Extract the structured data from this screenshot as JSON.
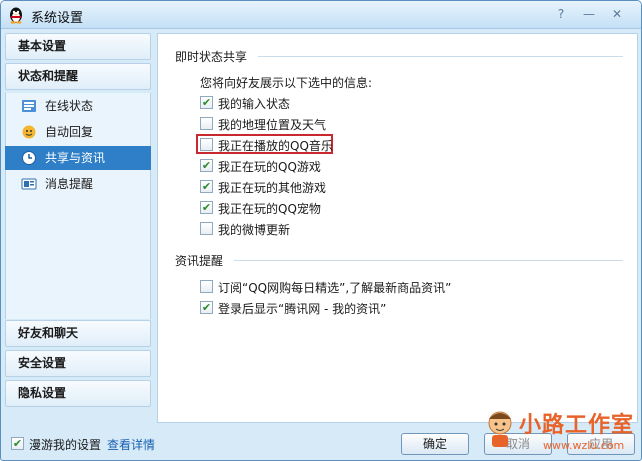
{
  "window": {
    "title": "系统设置",
    "help_glyph": "?",
    "minimize_glyph": "—",
    "close_glyph": "✕"
  },
  "sidebar": {
    "headers": {
      "basic": "基本设置",
      "status": "状态和提醒",
      "friends": "好友和聊天",
      "security": "安全设置",
      "privacy": "隐私设置"
    },
    "items": [
      {
        "label": "在线状态",
        "icon": "online-status-icon"
      },
      {
        "label": "自动回复",
        "icon": "auto-reply-icon"
      },
      {
        "label": "共享与资讯",
        "icon": "share-clock-icon",
        "active": true
      },
      {
        "label": "消息提醒",
        "icon": "message-alert-icon"
      }
    ]
  },
  "content": {
    "share_section": {
      "title": "即时状态共享",
      "prompt": "您将向好友展示以下选中的信息:",
      "options": [
        {
          "label": "我的输入状态",
          "checked": true
        },
        {
          "label": "我的地理位置及天气",
          "checked": false
        },
        {
          "label": "我正在播放的QQ音乐",
          "checked": false
        },
        {
          "label": "我正在玩的QQ游戏",
          "checked": true
        },
        {
          "label": "我正在玩的其他游戏",
          "checked": true
        },
        {
          "label": "我正在玩的QQ宠物",
          "checked": true
        },
        {
          "label": "我的微博更新",
          "checked": false
        }
      ]
    },
    "news_section": {
      "title": "资讯提醒",
      "options": [
        {
          "label": "订阅“QQ网购每日精选”,了解最新商品资讯”",
          "checked": false
        },
        {
          "label": "登录后显示“腾讯网 - 我的资讯”",
          "checked": true
        }
      ]
    }
  },
  "footer": {
    "roam_label": "漫游我的设置",
    "roam_checked": true,
    "details_link": "查看详情",
    "ok_label": "确定",
    "cancel_label": "取消",
    "apply_label": "应用"
  },
  "watermark": {
    "text": "小路工作室",
    "url": "www.wzlu.com"
  },
  "colors": {
    "accent_active": "#2f7fc8",
    "check": "#2a8a2a",
    "highlight_box": "#c8282e",
    "link": "#1860b0"
  }
}
